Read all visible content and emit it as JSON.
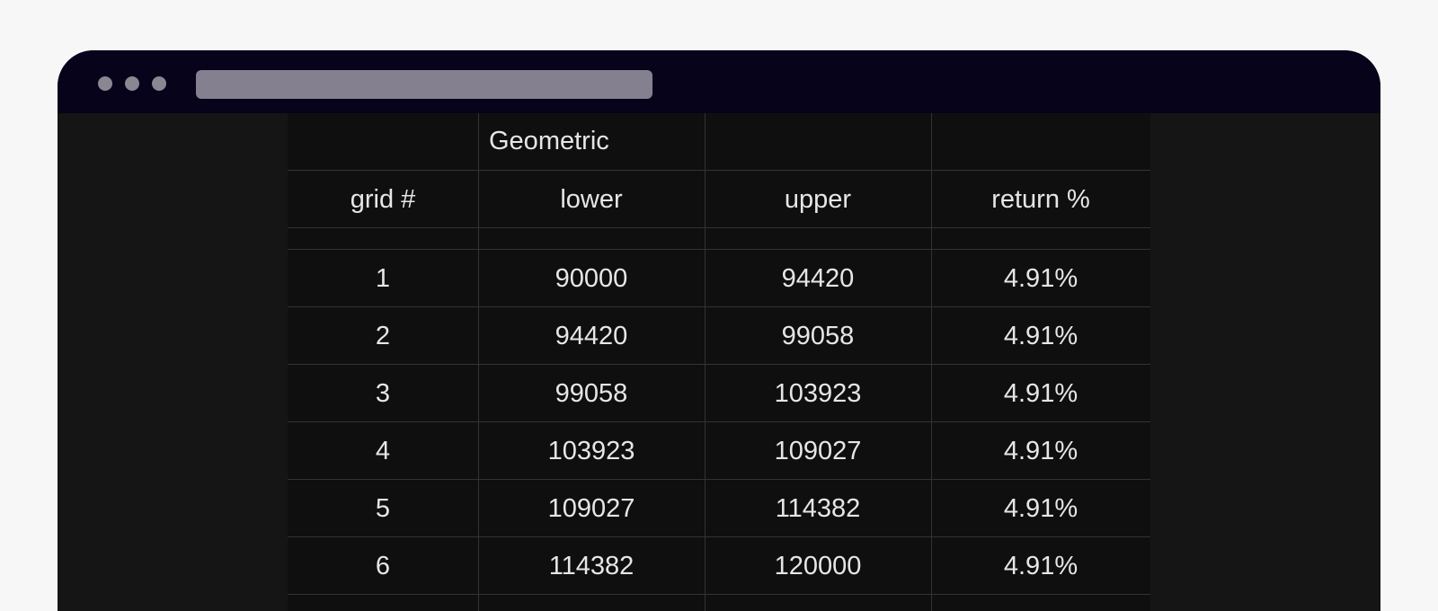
{
  "table": {
    "group_header": "Geometric",
    "columns": [
      "grid #",
      "lower",
      "upper",
      "return %"
    ],
    "rows": [
      [
        "1",
        "90000",
        "94420",
        "4.91%"
      ],
      [
        "2",
        "94420",
        "99058",
        "4.91%"
      ],
      [
        "3",
        "99058",
        "103923",
        "4.91%"
      ],
      [
        "4",
        "103923",
        "109027",
        "4.91%"
      ],
      [
        "5",
        "109027",
        "114382",
        "4.91%"
      ],
      [
        "6",
        "114382",
        "120000",
        "4.91%"
      ]
    ]
  },
  "colors": {
    "page_background": "#f7f7f7",
    "titlebar": "#07031b",
    "window_dots": "#8b8792",
    "address_bar": "#858090",
    "content_background": "#151515",
    "table_background": "#0f0f0f",
    "grid_lines": "#333333",
    "text": "#e6e6e6"
  }
}
